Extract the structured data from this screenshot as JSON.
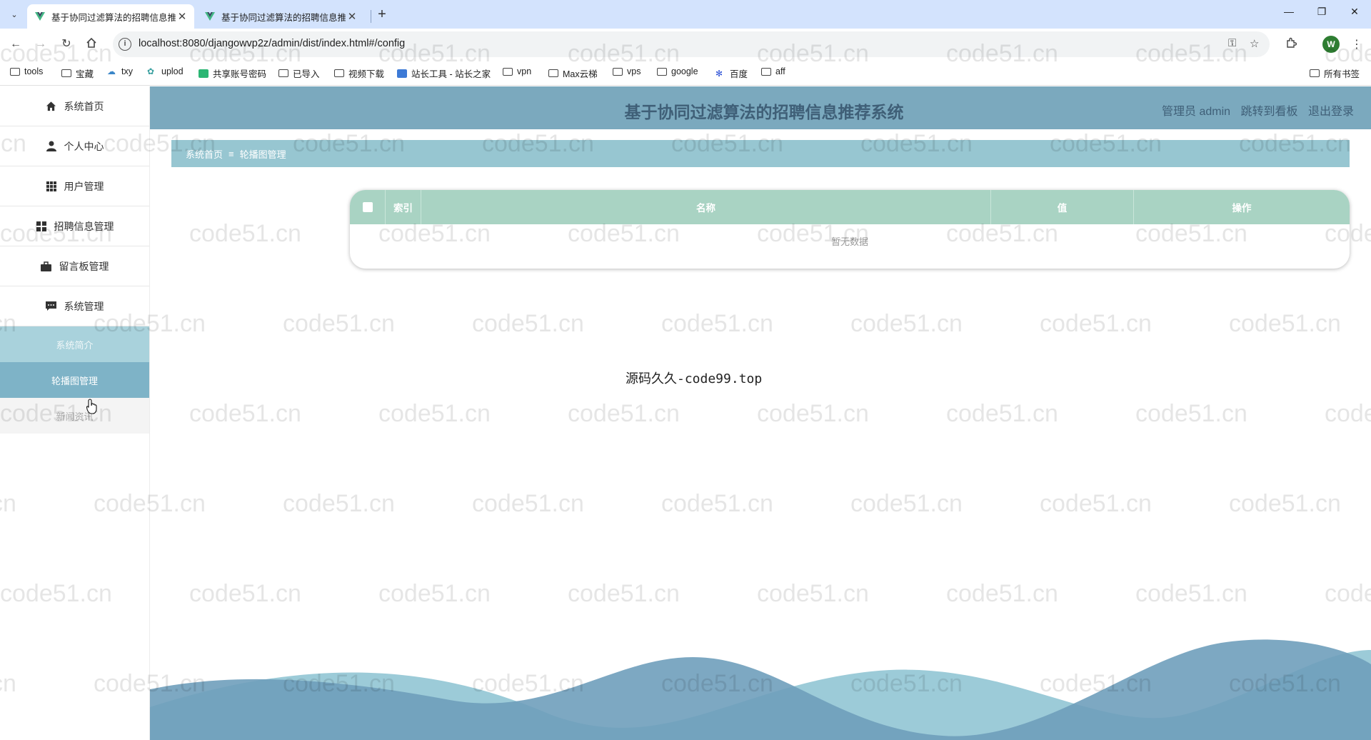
{
  "browser": {
    "tabs": [
      {
        "title": "基于协同过滤算法的招聘信息推",
        "active": true
      },
      {
        "title": "基于协同过滤算法的招聘信息推",
        "active": false
      }
    ],
    "url": "localhost:8080/djangowvp2z/admin/dist/index.html#/config",
    "profile_initial": "W",
    "bookmarks": [
      "tools",
      "宝藏",
      "txy",
      "uplod",
      "共享账号密码",
      "已导入",
      "视频下载",
      "站长工具 - 站长之家",
      "vpn",
      "Max云梯",
      "vps",
      "google",
      "百度",
      "aff"
    ],
    "all_bookmarks": "所有书签"
  },
  "sidebar": {
    "items": [
      {
        "label": "系统首页",
        "icon": "home-icon"
      },
      {
        "label": "个人中心",
        "icon": "user-icon"
      },
      {
        "label": "用户管理",
        "icon": "grid-icon"
      },
      {
        "label": "招聘信息管理",
        "icon": "apps-icon"
      },
      {
        "label": "留言板管理",
        "icon": "briefcase-icon"
      },
      {
        "label": "系统管理",
        "icon": "chat-icon"
      }
    ],
    "sub_items": [
      "系统简介",
      "轮播图管理",
      "新闻资讯"
    ]
  },
  "header": {
    "title": "基于协同过滤算法的招聘信息推荐系统",
    "admin": "管理员 admin",
    "dashboard": "跳转到看板",
    "logout": "退出登录"
  },
  "breadcrumb": {
    "home": "系统首页",
    "separator": "≡",
    "current": "轮播图管理"
  },
  "table": {
    "columns": [
      "索引",
      "名称",
      "值",
      "操作"
    ],
    "empty_text": "暂无数据"
  },
  "source_text": "源码久久-code99.top",
  "watermark_text": "code51.cn",
  "colors": {
    "header": "#7ba9be",
    "breadcrumb": "#97c6d1",
    "table_header": "#a9d3c3",
    "sub_active": "#7eb3c7",
    "wave_dark": "#6f9fbb",
    "wave_light": "#9ccbd8"
  }
}
